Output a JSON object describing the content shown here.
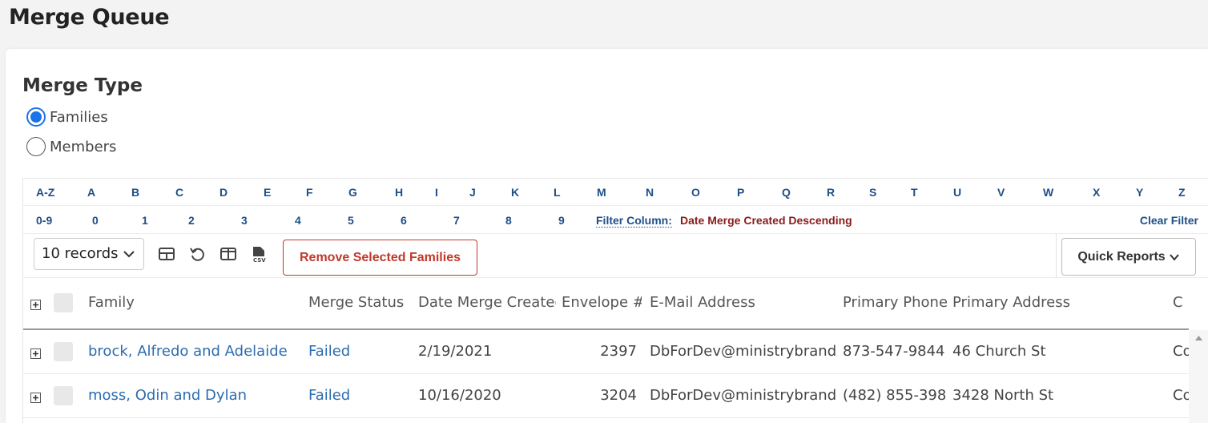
{
  "page": {
    "title": "Merge Queue"
  },
  "merge_type": {
    "title": "Merge Type",
    "options": [
      {
        "label": "Families",
        "checked": true
      },
      {
        "label": "Members",
        "checked": false
      }
    ]
  },
  "alpha_filter": {
    "letters": [
      "A-Z",
      "A",
      "B",
      "C",
      "D",
      "E",
      "F",
      "G",
      "H",
      "I",
      "J",
      "K",
      "L",
      "M",
      "N",
      "O",
      "P",
      "Q",
      "R",
      "S",
      "T",
      "U",
      "V",
      "W",
      "X",
      "Y",
      "Z"
    ],
    "numbers": [
      "0-9",
      "0",
      "1",
      "2",
      "3",
      "4",
      "5",
      "6",
      "7",
      "8",
      "9"
    ],
    "filter_label": "Filter Column:",
    "filter_value": "Date Merge Created Descending",
    "clear_label": "Clear Filter"
  },
  "toolbar": {
    "records_select": "10 records",
    "icons": [
      "table-view-icon",
      "reset-icon",
      "columns-icon",
      "csv-export-icon"
    ],
    "remove_label": "Remove Selected Families",
    "quick_reports_label": "Quick Reports"
  },
  "table": {
    "columns": [
      "Family",
      "Merge Status",
      "Date Merge Created",
      "Envelope #",
      "E-Mail Address",
      "Primary Phone",
      "Primary Address",
      "C"
    ],
    "rows": [
      {
        "family": "brock, Alfredo and Adelaide",
        "merge_status": "Failed",
        "date_created": "2/19/2021",
        "envelope": "2397",
        "email": "DbForDev@ministrybrands.",
        "phone": "873-547-9844",
        "address": "46 Church St",
        "c": "Co"
      },
      {
        "family": "moss, Odin and Dylan",
        "merge_status": "Failed",
        "date_created": "10/16/2020",
        "envelope": "3204",
        "email": "DbForDev@ministrybrands.",
        "phone": "(482) 855-398",
        "address": "3428 North St",
        "c": "Co"
      }
    ]
  },
  "colors": {
    "link": "#2c6cb0",
    "alpha_link": "#1f4f88",
    "filter_value": "#8b1a1a",
    "danger": "#c0392b",
    "radio_accent": "#1a73e8"
  }
}
